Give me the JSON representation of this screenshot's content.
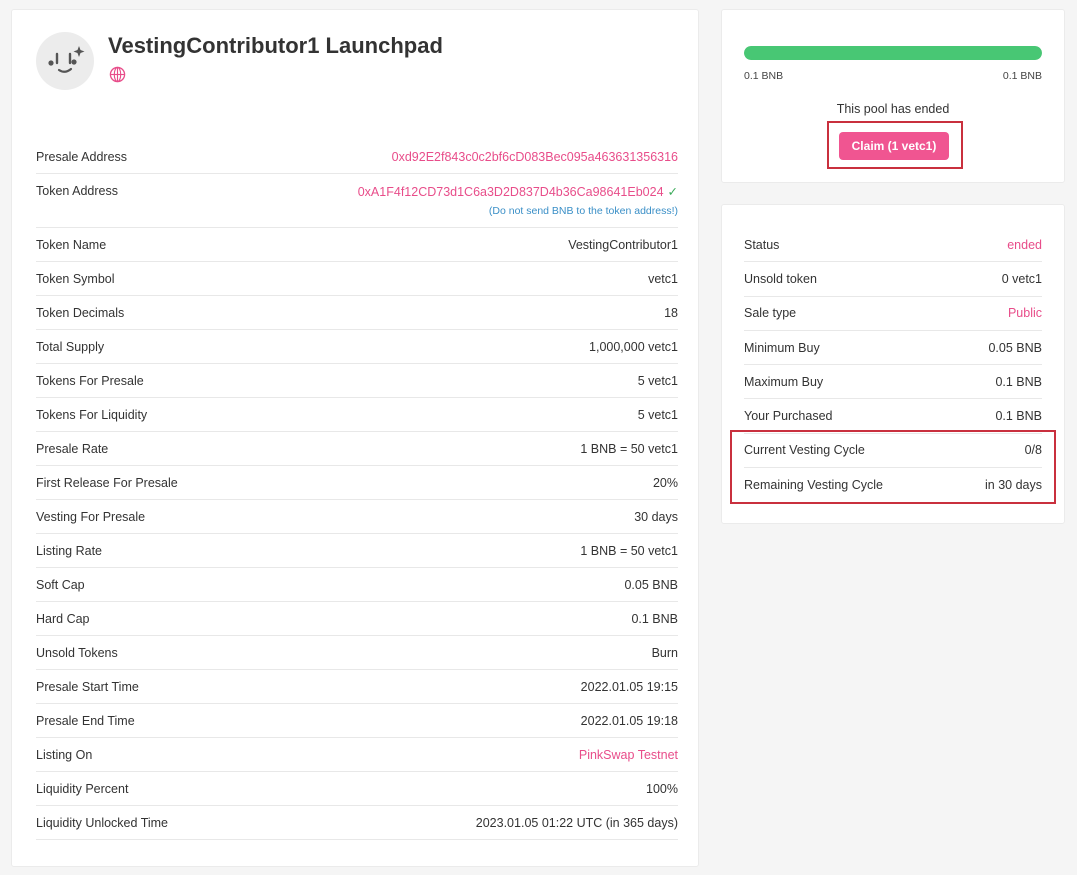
{
  "header": {
    "title": "VestingContributor1 Launchpad",
    "avatar_icon": "smiling-sparkle-face-icon",
    "website_icon": "globe-icon"
  },
  "details": [
    {
      "label": "Presale Address",
      "value": "0xd92E2f843c0c2bf6cD083Bec095a463631356316",
      "style": "link"
    },
    {
      "label": "Token Address",
      "value": "0xA1F4f12CD73d1C6a3D2D837D4b36Ca98641Eb024",
      "style": "link",
      "verified": true,
      "note": "(Do not send BNB to the token address!)"
    },
    {
      "label": "Token Name",
      "value": "VestingContributor1"
    },
    {
      "label": "Token Symbol",
      "value": "vetc1"
    },
    {
      "label": "Token Decimals",
      "value": "18"
    },
    {
      "label": "Total Supply",
      "value": "1,000,000 vetc1"
    },
    {
      "label": "Tokens For Presale",
      "value": "5 vetc1"
    },
    {
      "label": "Tokens For Liquidity",
      "value": "5 vetc1"
    },
    {
      "label": "Presale Rate",
      "value": "1 BNB = 50 vetc1"
    },
    {
      "label": "First Release For Presale",
      "value": "20%"
    },
    {
      "label": "Vesting For Presale",
      "value": "30 days"
    },
    {
      "label": "Listing Rate",
      "value": "1 BNB = 50 vetc1"
    },
    {
      "label": "Soft Cap",
      "value": "0.05 BNB"
    },
    {
      "label": "Hard Cap",
      "value": "0.1 BNB"
    },
    {
      "label": "Unsold Tokens",
      "value": "Burn"
    },
    {
      "label": "Presale Start Time",
      "value": "2022.01.05 19:15"
    },
    {
      "label": "Presale End Time",
      "value": "2022.01.05 19:18"
    },
    {
      "label": "Listing On",
      "value": "PinkSwap Testnet",
      "style": "link"
    },
    {
      "label": "Liquidity Percent",
      "value": "100%"
    },
    {
      "label": "Liquidity Unlocked Time",
      "value": "2023.01.05 01:22 UTC (in 365 days)"
    }
  ],
  "progress": {
    "fraction": 1.0,
    "min_label": "0.1 BNB",
    "max_label": "0.1 BNB",
    "status_text": "This pool has ended",
    "claim_label": "Claim (1 vetc1)",
    "bar_color": "#48c774"
  },
  "status": [
    {
      "label": "Status",
      "value": "ended",
      "style": "link"
    },
    {
      "label": "Unsold token",
      "value": "0 vetc1"
    },
    {
      "label": "Sale type",
      "value": "Public",
      "style": "link"
    },
    {
      "label": "Minimum Buy",
      "value": "0.05 BNB"
    },
    {
      "label": "Maximum Buy",
      "value": "0.1 BNB"
    },
    {
      "label": "Your Purchased",
      "value": "0.1 BNB"
    },
    {
      "label": "Current Vesting Cycle",
      "value": "0/8"
    },
    {
      "label": "Remaining Vesting Cycle",
      "value": "in 30 days"
    }
  ],
  "colors": {
    "accent": "#e84d8a",
    "highlight_box": "#c9303e",
    "note": "#3a8fc7",
    "verified": "#3bab5a"
  }
}
